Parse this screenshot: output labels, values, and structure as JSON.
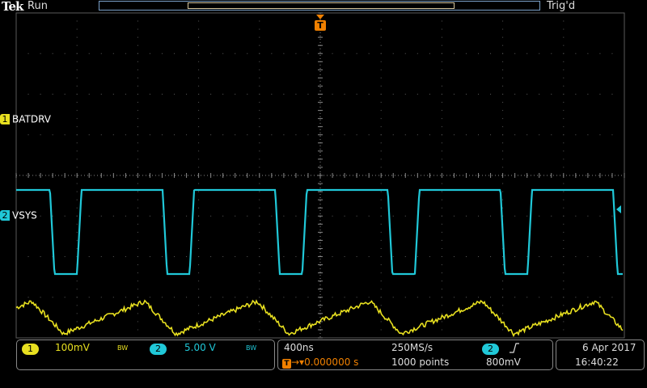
{
  "header": {
    "brand": "Tek",
    "run_state": "Run",
    "trigger_state": "Trig'd",
    "trigger_marker": "T"
  },
  "colors": {
    "ch1": "#e8e020",
    "ch2": "#20c8d8",
    "grid": "#5a5a5a",
    "trigger": "#f08000",
    "background": "#000000"
  },
  "channels": [
    {
      "badge": "1",
      "name": "BATDRV",
      "color": "#e8e020"
    },
    {
      "badge": "2",
      "name": "VSYS",
      "color": "#20c8d8"
    }
  ],
  "status": {
    "ch1_badge": "1",
    "ch1_scale": "100mV",
    "ch1_bw": "BW",
    "ch2_badge": "2",
    "ch2_scale": "5.00 V",
    "ch2_bw": "BW",
    "timebase": "400ns",
    "sample_rate": "250MS/s",
    "trigger_source": "2",
    "trigger_slope_icon": "rising-edge-icon",
    "trigger_delay": "0.000000 s",
    "record_length": "1000 points",
    "trigger_level": "800mV",
    "date": "6 Apr  2017",
    "time": "16:40:22"
  },
  "chart_data": {
    "type": "line",
    "grid": true,
    "x_divisions": 10,
    "y_divisions": 8,
    "series": [
      {
        "name": "BATDRV",
        "shape": "sawtooth-ripple",
        "periods": 5.4,
        "y_divisions_center": -3.5,
        "amplitude_divisions": 0.8
      },
      {
        "name": "VSYS",
        "shape": "square",
        "periods": 5.4,
        "duty_high": 0.72,
        "y_high_divisions": 0.25,
        "y_low_divisions": -2.5
      }
    ]
  }
}
